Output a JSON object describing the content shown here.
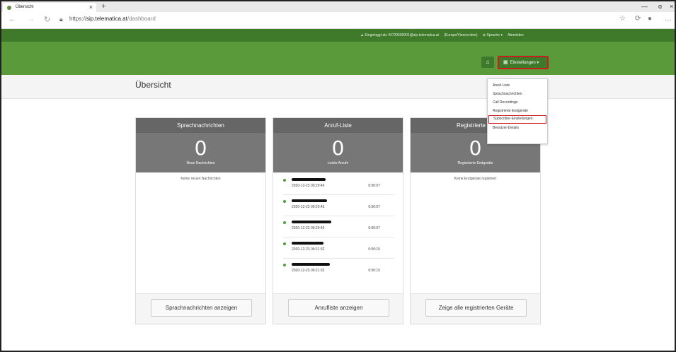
{
  "browser": {
    "tab_title": "Übersicht",
    "tab_close": "×",
    "new_tab": "+",
    "url_scheme": "https://",
    "url_host": "sip.telematica.at",
    "url_path": "/dashboard",
    "win_minimize": "—",
    "win_maximize": "ɑ",
    "win_close": "×"
  },
  "infobar": {
    "logged_in": "▲ Eingeloggt als 43720560001@sip.telematica.at",
    "timezone": "(Europe/Vienna time)",
    "language": "⊕ Sprache ▾",
    "logout": "Abmelden"
  },
  "header": {
    "home_icon": "⌂",
    "settings_label": "Einstellungen ▾",
    "settings_grid_icon": "▦"
  },
  "page": {
    "title": "Übersicht"
  },
  "dropdown": {
    "items": [
      {
        "label": "Anruf-Liste"
      },
      {
        "label": "Sprachnachrichten"
      },
      {
        "label": "Call Recordings"
      },
      {
        "label": "Registrierte Endgeräte"
      },
      {
        "label": "Subscriber-Einstellungen",
        "highlighted": true
      },
      {
        "label": "Benutzer-Details"
      }
    ]
  },
  "cards": {
    "voicemail": {
      "title": "Sprachnachrichten",
      "count": "0",
      "count_label": "Neue Nachrichten",
      "empty_text": "Keine neuen Nachrichten",
      "button": "Sprachnachrichten anzeigen"
    },
    "calls": {
      "title": "Anruf-Liste",
      "count": "0",
      "count_label": "Letzte Anrufe",
      "button": "Anrufliste anzeigen",
      "items": [
        {
          "date": "2020-12-23 09:29:46",
          "duration": "0:00:07"
        },
        {
          "date": "2020-12-23 09:29:45",
          "duration": "0:00:07"
        },
        {
          "date": "2020-12-23 09:29:45",
          "duration": "0:00:07"
        },
        {
          "date": "2020-12-23 09:21:32",
          "duration": "0:00:15"
        },
        {
          "date": "2020-12-23 09:21:32",
          "duration": "0:00:15"
        }
      ]
    },
    "devices": {
      "title": "Registrierte En",
      "count": "0",
      "count_label": "Registrierte Endgeräte",
      "empty_text": "Keine Endgeräte registriert",
      "button": "Zeige alle registrierten Geräte"
    }
  },
  "colors": {
    "header_green": "#5a9a3a",
    "infobar_green": "#3e7a2a",
    "highlight_red": "#cc1c1c",
    "card_head": "#666666"
  }
}
